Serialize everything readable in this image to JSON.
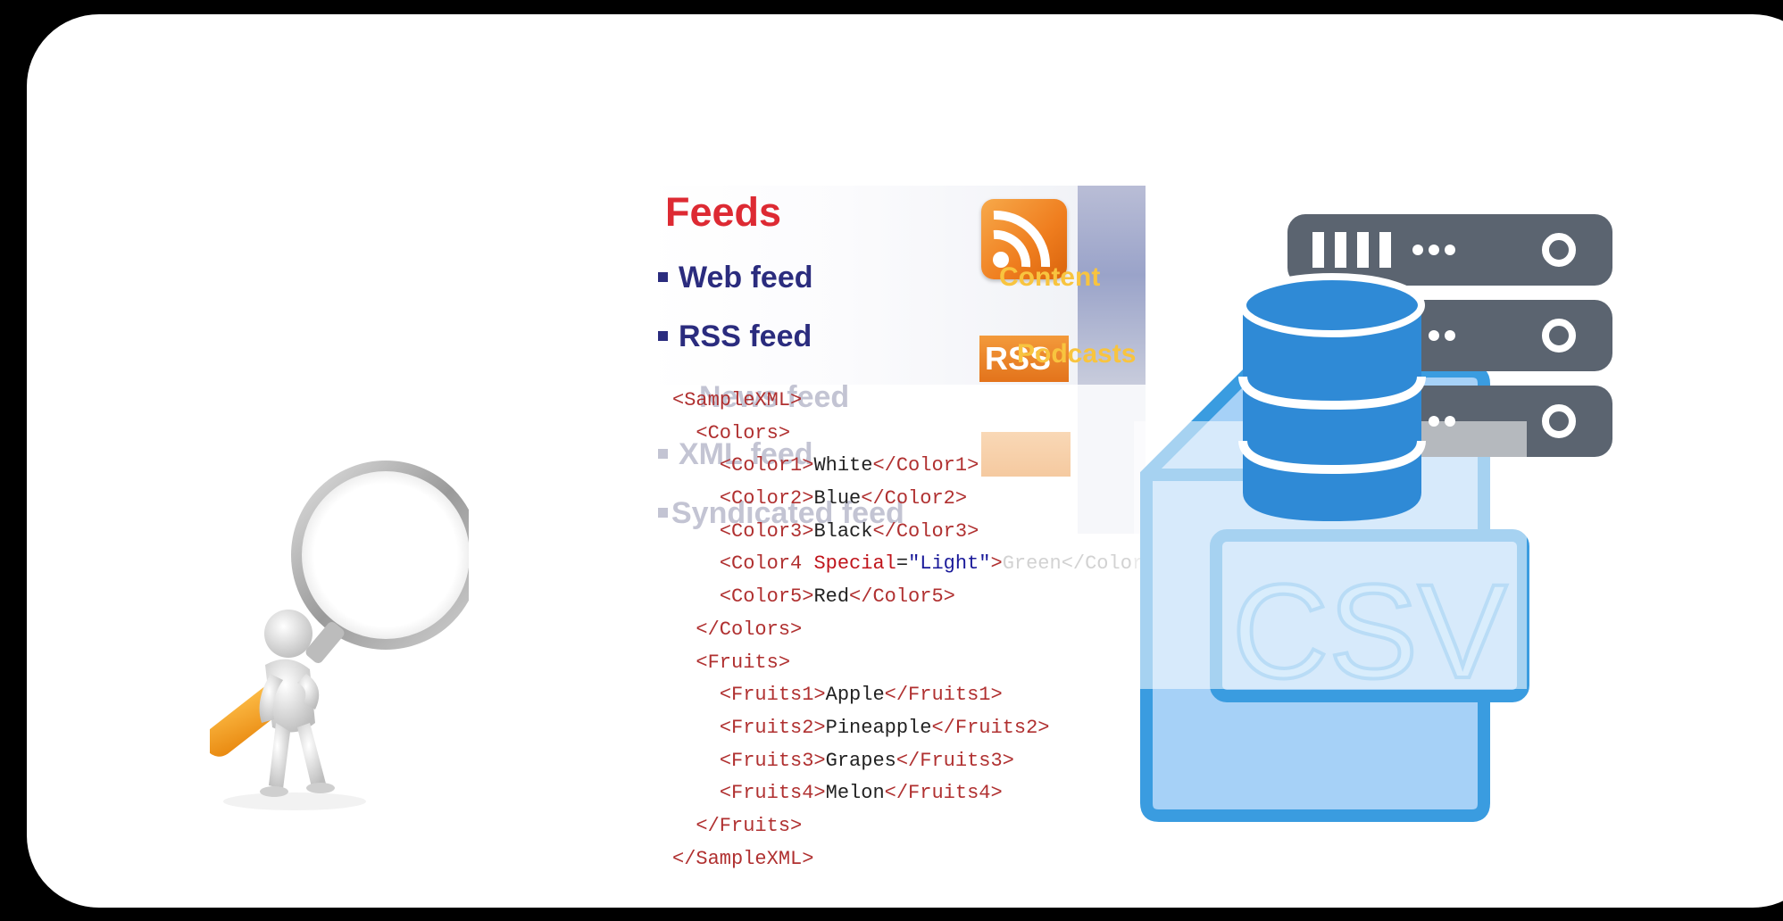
{
  "feeds_card": {
    "title": "Feeds",
    "items": [
      "Web feed",
      "RSS feed"
    ],
    "faint_items": [
      "News feed",
      "XML feed",
      "Syndicated feed"
    ],
    "overlay_words": [
      "Content",
      "Podcasts"
    ],
    "rss_badge": "RSS"
  },
  "xml_sample": {
    "lines": [
      {
        "indent": 0,
        "open": "<SampleXML>",
        "text": "",
        "close": ""
      },
      {
        "indent": 1,
        "open": "<Colors>",
        "text": "",
        "close": ""
      },
      {
        "indent": 2,
        "open": "<Color1>",
        "text": "White",
        "close": "</Color1>"
      },
      {
        "indent": 2,
        "open": "<Color2>",
        "text": "Blue",
        "close": "</Color2>"
      },
      {
        "indent": 2,
        "open": "<Color3>",
        "text": "Black",
        "close": "</Color3>"
      },
      {
        "indent": 2,
        "open": "<Color4 ",
        "attr": "Special",
        "attr_val": "\"Light\"",
        "open_end": ">",
        "text": "Green",
        "close": "</Color4>"
      },
      {
        "indent": 2,
        "open": "<Color5>",
        "text": "Red",
        "close": "</Color5>"
      },
      {
        "indent": 1,
        "open": "</Colors>",
        "text": "",
        "close": ""
      },
      {
        "indent": 1,
        "open": "<Fruits>",
        "text": "",
        "close": ""
      },
      {
        "indent": 2,
        "open": "<Fruits1>",
        "text": "Apple",
        "close": "</Fruits1>"
      },
      {
        "indent": 2,
        "open": "<Fruits2>",
        "text": "Pineapple",
        "close": "</Fruits2>"
      },
      {
        "indent": 2,
        "open": "<Fruits3>",
        "text": "Grapes",
        "close": "</Fruits3>"
      },
      {
        "indent": 2,
        "open": "<Fruits4>",
        "text": "Melon",
        "close": "</Fruits4>"
      },
      {
        "indent": 1,
        "open": "</Fruits>",
        "text": "",
        "close": ""
      },
      {
        "indent": 0,
        "open": "</SampleXML>",
        "text": "",
        "close": ""
      }
    ]
  },
  "csv_icon": {
    "label": "CSV",
    "file_color": "#3a9ce0",
    "file_fill": "#a6d1f7",
    "database_color": "#2f8ad6",
    "server_color": "#5b6470"
  },
  "colors": {
    "frame": "#000000",
    "background": "#ffffff",
    "feeds_title": "#dd2a33",
    "feeds_items": "#2b2c7e",
    "rss_orange": "#ef7d1e"
  }
}
